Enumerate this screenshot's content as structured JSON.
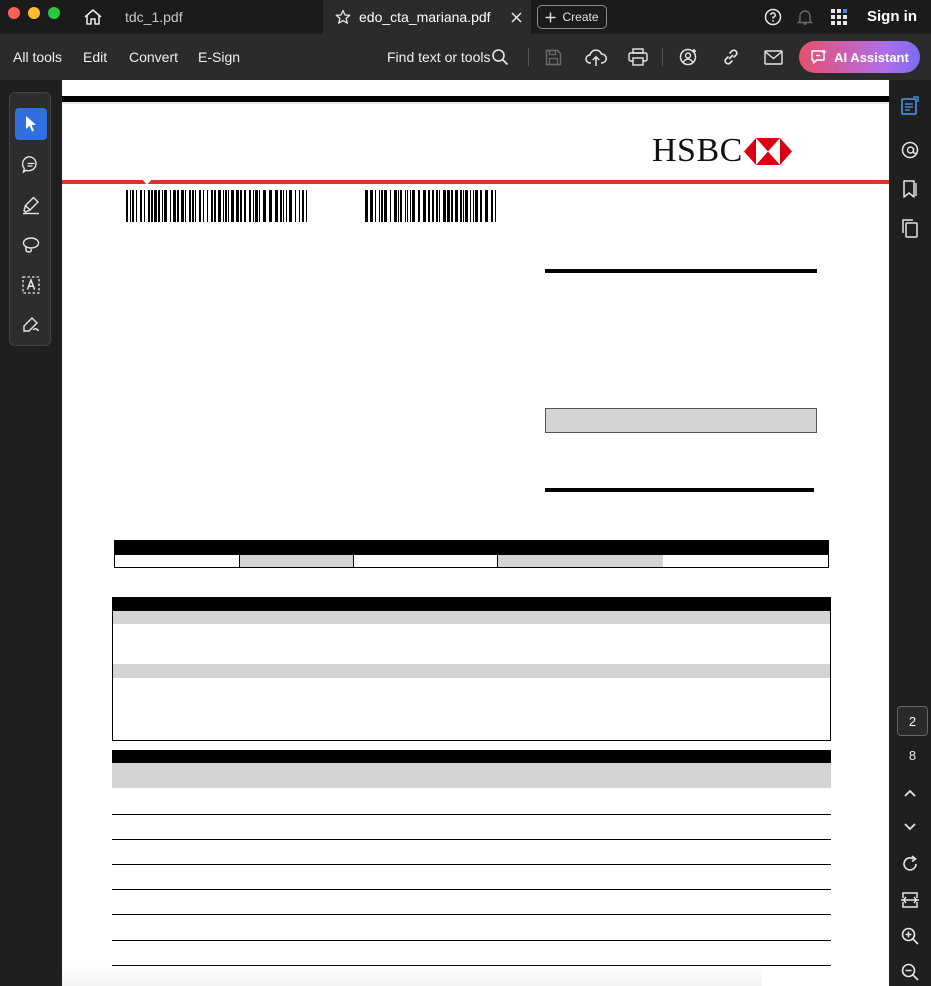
{
  "window": {
    "tabs": [
      {
        "label": "tdc_1.pdf",
        "active": false
      },
      {
        "label": "edo_cta_mariana.pdf",
        "active": true
      }
    ],
    "create_label": "Create",
    "signin_label": "Sign in"
  },
  "toolbar": {
    "menu": [
      "All tools",
      "Edit",
      "Convert",
      "E-Sign"
    ],
    "find_label": "Find text or tools",
    "ai_label": "AI Assistant"
  },
  "document": {
    "bank_logo_text": "HSBC",
    "current_page": "2",
    "total_pages": "8"
  },
  "colors": {
    "accent_blue": "#2f6fe0",
    "hsbc_red": "#db0011",
    "red_rule": "#d9342b",
    "ai_gradient_start": "#e8506b",
    "ai_gradient_end": "#7b6cf2"
  },
  "icons": {
    "left_tools": [
      "select-arrow-icon",
      "comment-icon",
      "highlight-pen-icon",
      "draw-lasso-icon",
      "text-select-icon",
      "fill-sign-icon"
    ],
    "right_panel": [
      "comments-panel-icon",
      "mentions-icon",
      "bookmarks-icon",
      "pages-icon",
      "chevron-up-icon",
      "chevron-down-icon",
      "rotate-icon",
      "fit-page-icon",
      "zoom-in-icon",
      "zoom-out-icon"
    ]
  }
}
